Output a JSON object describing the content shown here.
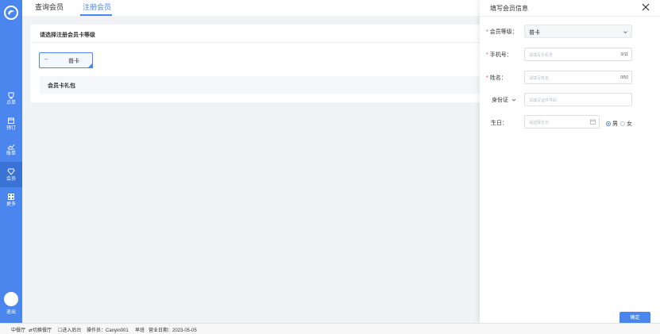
{
  "sidebar": {
    "items": [
      {
        "label": "点单",
        "icon": "cup-icon"
      },
      {
        "label": "预订",
        "icon": "calendar-icon"
      },
      {
        "label": "账单",
        "icon": "chart-icon"
      },
      {
        "label": "会员",
        "icon": "member-icon"
      },
      {
        "label": "更多",
        "icon": "grid-icon"
      }
    ],
    "logout": "退出"
  },
  "tabs": [
    {
      "label": "查询会员"
    },
    {
      "label": "注册会员"
    }
  ],
  "main": {
    "section_title": "请选择注册会员卡等级",
    "level_card": {
      "prefix": "--",
      "name": "普卡"
    },
    "gift_title": "会员卡礼包"
  },
  "drawer": {
    "title": "填写会员信息",
    "fields": {
      "level": {
        "label": "会员等级：",
        "value": "普卡"
      },
      "phone": {
        "label": "手机号：",
        "placeholder": "请填写手机号",
        "count": "0/11"
      },
      "name": {
        "label": "姓名：",
        "placeholder": "请填写姓名",
        "count": "0/50"
      },
      "id_card": {
        "label": "身份证",
        "placeholder": "请填写证件号码"
      },
      "birthday": {
        "label": "生日：",
        "placeholder": "请选择生日"
      }
    },
    "gender": {
      "male": "男",
      "female": "女"
    },
    "confirm": "确定"
  },
  "statusbar": {
    "hall": "中餐厅",
    "switch_hall": "切换餐厅",
    "enter_admin": "进入后台",
    "operator": "操作员：Canyin001",
    "shift": "早班",
    "biz_date": "营业日期：2023-05-05"
  },
  "colors": {
    "primary": "#4a86ee",
    "required": "#e54d42"
  }
}
